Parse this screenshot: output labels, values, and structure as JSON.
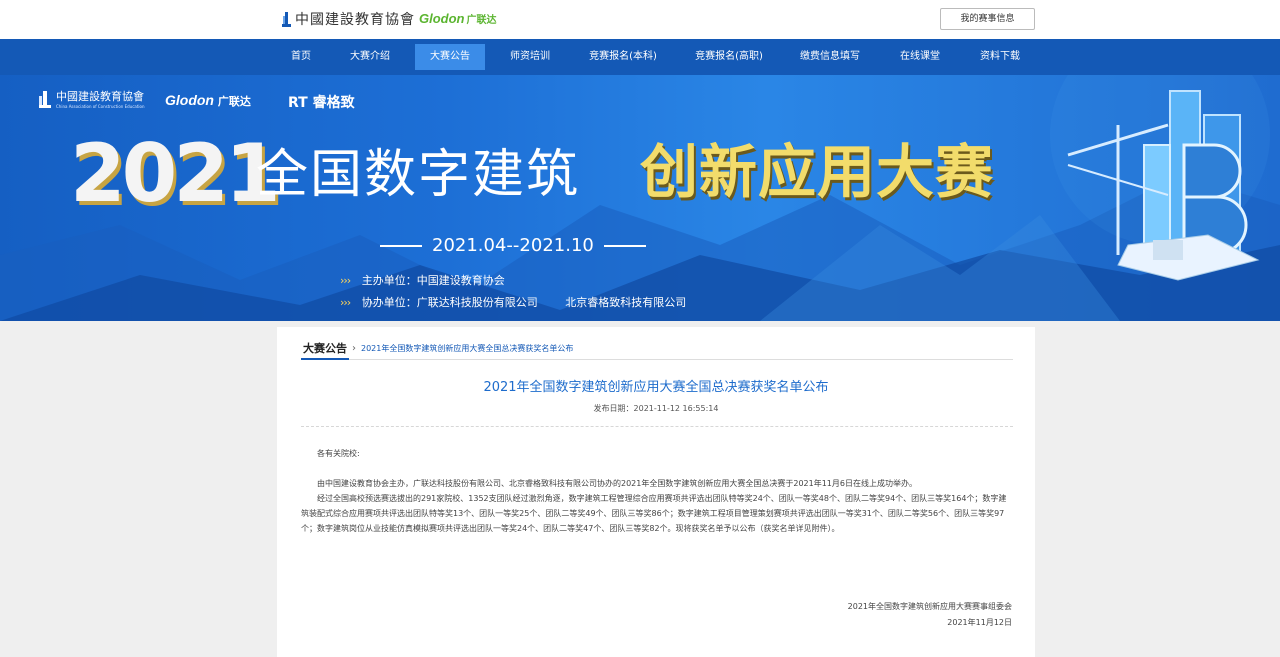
{
  "header": {
    "logo_cace": "中國建設教育協會",
    "logo_glodon": "Glodon",
    "logo_glodon_cn": "广联达",
    "my_info_button": "我的赛事信息"
  },
  "nav": {
    "items": [
      "首页",
      "大赛介绍",
      "大赛公告",
      "师资培训",
      "竞赛报名(本科)",
      "竞赛报名(高职)",
      "缴费信息填写",
      "在线课堂",
      "资料下载"
    ],
    "active_index": 2
  },
  "banner": {
    "logo1": "中國建設教育協會",
    "logo1_sub": "China Association of Construction Education",
    "logo2": "Glodon",
    "logo2_cn": "广联达",
    "logo3": "RT 睿格致",
    "year": "2021",
    "title_part1": "全国数字建筑",
    "title_part2": "创新应用大赛",
    "date_range": "2021.04--2021.10",
    "host_label": "主办单位：中国建设教育协会",
    "coorg_label": "协办单位：广联达科技股份有限公司",
    "coorg_second": "北京睿格致科技有限公司",
    "arrows": "›››"
  },
  "breadcrumb": {
    "home": "大赛公告",
    "current": "2021年全国数字建筑创新应用大赛全国总决赛获奖名单公布"
  },
  "article": {
    "title": "2021年全国数字建筑创新应用大赛全国总决赛获奖名单公布",
    "meta": "发布日期：2021-11-12 16:55:14",
    "salutation": "各有关院校:",
    "para1": "由中国建设教育协会主办，广联达科技股份有限公司、北京睿格致科技有限公司协办的2021年全国数字建筑创新应用大赛全国总决赛于2021年11月6日在线上成功举办。",
    "para2": "经过全国高校预选赛选拔出的291家院校、1352支团队经过激烈角逐，数字建筑工程管理综合应用赛项共评选出团队特等奖24个、团队一等奖48个、团队二等奖94个、团队三等奖164个；数字建筑装配式综合应用赛项共评选出团队特等奖13个、团队一等奖25个、团队二等奖49个、团队三等奖86个；数字建筑工程项目管理策划赛项共评选出团队一等奖31个、团队二等奖56个、团队三等奖97个；数字建筑岗位从业技能仿真模拟赛项共评选出团队一等奖24个、团队二等奖47个、团队三等奖82个。现将获奖名单予以公布（获奖名单详见附件）。",
    "sign_org": "2021年全国数字建筑创新应用大赛赛事组委会",
    "sign_date": "2021年11月12日"
  },
  "colors": {
    "nav_bg": "#1459b6",
    "nav_active": "#3b8ce8",
    "title_blue": "#1e6ccc",
    "glodon_green": "#5cb531",
    "banner_gold": "#f2dc6b"
  }
}
